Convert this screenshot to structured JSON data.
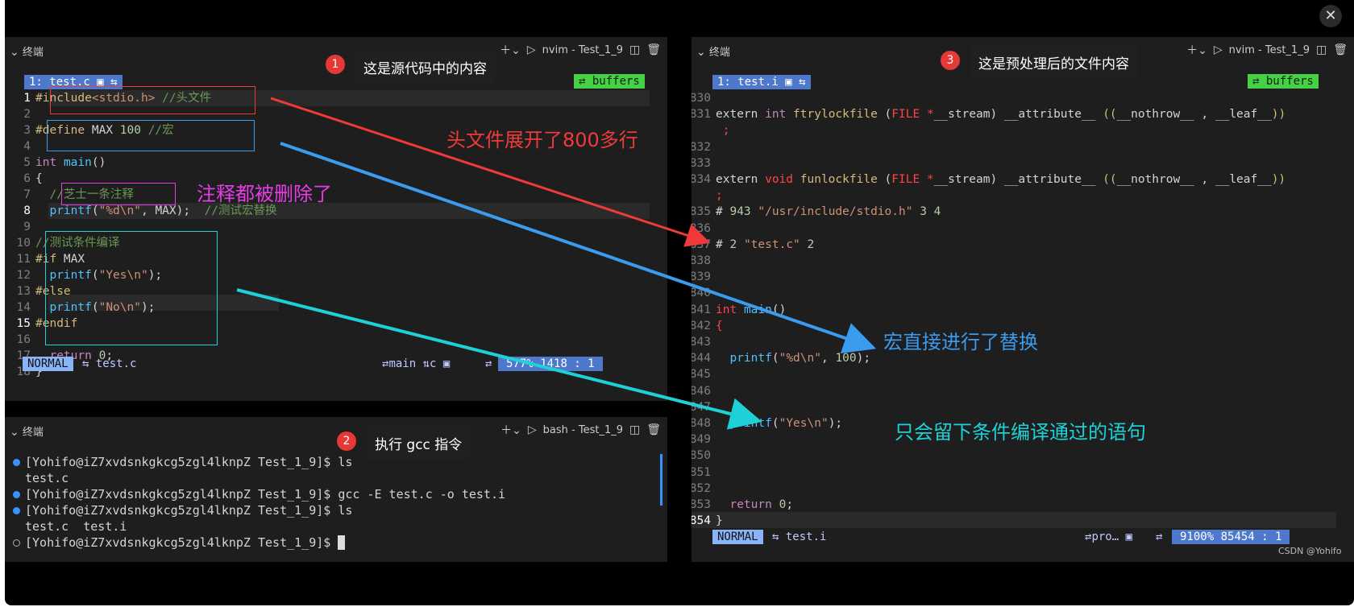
{
  "viewer": {
    "close_glyph": "✕",
    "prev_glyph": "〈",
    "next_glyph": "〉",
    "watermark": "CSDN @Yohifo"
  },
  "left_top": {
    "panel_title": "终端",
    "tab_label": "nvim - Test_1_9",
    "file_tab": "1: test.c",
    "buffers_label": "buffers",
    "mode": "NORMAL",
    "status_file": "test.c",
    "status_branch": "main",
    "status_lang": "c",
    "status_pct": "577%",
    "status_pos": "1418 :  1"
  },
  "left_bottom": {
    "panel_title": "终端",
    "tab_label": "bash - Test_1_9",
    "lines": [
      {
        "dot": "filled",
        "text": "[Yohifo@iZ7xvdsnkgkcg5zgl4lknpZ Test_1_9]$ ls"
      },
      {
        "dot": "none",
        "text": "test.c"
      },
      {
        "dot": "filled",
        "text": "[Yohifo@iZ7xvdsnkgkcg5zgl4lknpZ Test_1_9]$ gcc -E test.c -o test.i"
      },
      {
        "dot": "filled",
        "text": "[Yohifo@iZ7xvdsnkgkcg5zgl4lknpZ Test_1_9]$ ls"
      },
      {
        "dot": "none",
        "text": "test.c  test.i"
      },
      {
        "dot": "empty",
        "text": "[Yohifo@iZ7xvdsnkgkcg5zgl4lknpZ Test_1_9]$ "
      }
    ]
  },
  "right": {
    "panel_title": "终端",
    "tab_label": "nvim - Test_1_9",
    "file_tab": "1: test.i",
    "buffers_label": "buffers",
    "mode": "NORMAL",
    "status_file": "test.i",
    "status_branch": "pro…",
    "status_pct": "9100%",
    "status_pos": "85454 :  1"
  },
  "callouts": {
    "c1": {
      "num": "1",
      "text": "这是源代码中的内容"
    },
    "c2": {
      "num": "2",
      "text": "执行 gcc 指令"
    },
    "c3": {
      "num": "3",
      "text": "这是预处理后的文件内容"
    }
  },
  "annotations": {
    "header_expand": "头文件展开了800多行",
    "comments_removed": "注释都被删除了",
    "macro_replaced": "宏直接进行了替换",
    "cond_compile": "只会留下条件编译通过的语句"
  },
  "colors": {
    "red": "#f03a3a",
    "blue": "#3a9bef",
    "cyan": "#1ed1d6",
    "magenta": "#e63de6"
  }
}
